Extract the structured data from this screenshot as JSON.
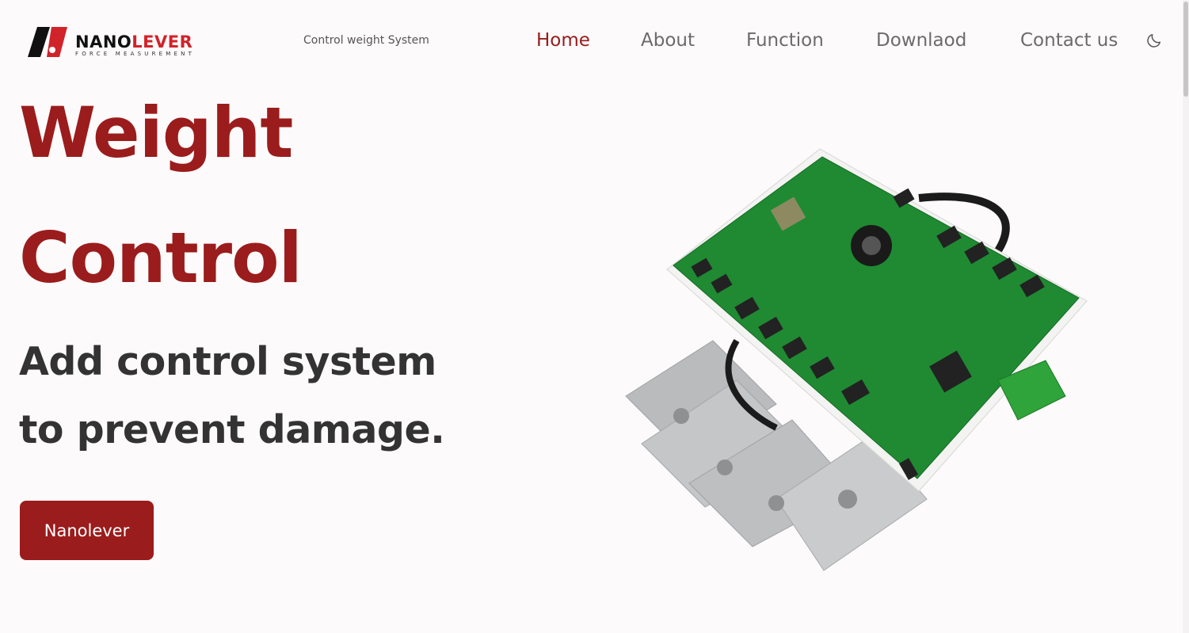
{
  "brand": {
    "name_dark": "NANO",
    "name_red": "LEVER",
    "sub": "FORCE MEASUREMENT",
    "colors": {
      "red": "#d1232a",
      "dark": "#111111"
    }
  },
  "header": {
    "tagline": "Control weight System",
    "nav": [
      {
        "label": "Home",
        "active": true
      },
      {
        "label": "About",
        "active": false
      },
      {
        "label": "Function",
        "active": false
      },
      {
        "label": "Downlaod",
        "active": false
      },
      {
        "label": "Contact us",
        "active": false
      }
    ],
    "theme_toggle_icon": "moon-icon"
  },
  "hero": {
    "title_line1": "Weight",
    "title_line2": "Control",
    "subtitle_line1": "Add control system",
    "subtitle_line2": "to prevent damage.",
    "cta_label": "Nanolever",
    "image_icon": "control-board-with-load-cells-image"
  },
  "colors": {
    "accent": "#9b1c1c",
    "text": "#333333",
    "nav_text": "#6b6b6b",
    "background": "#fcfafb"
  }
}
